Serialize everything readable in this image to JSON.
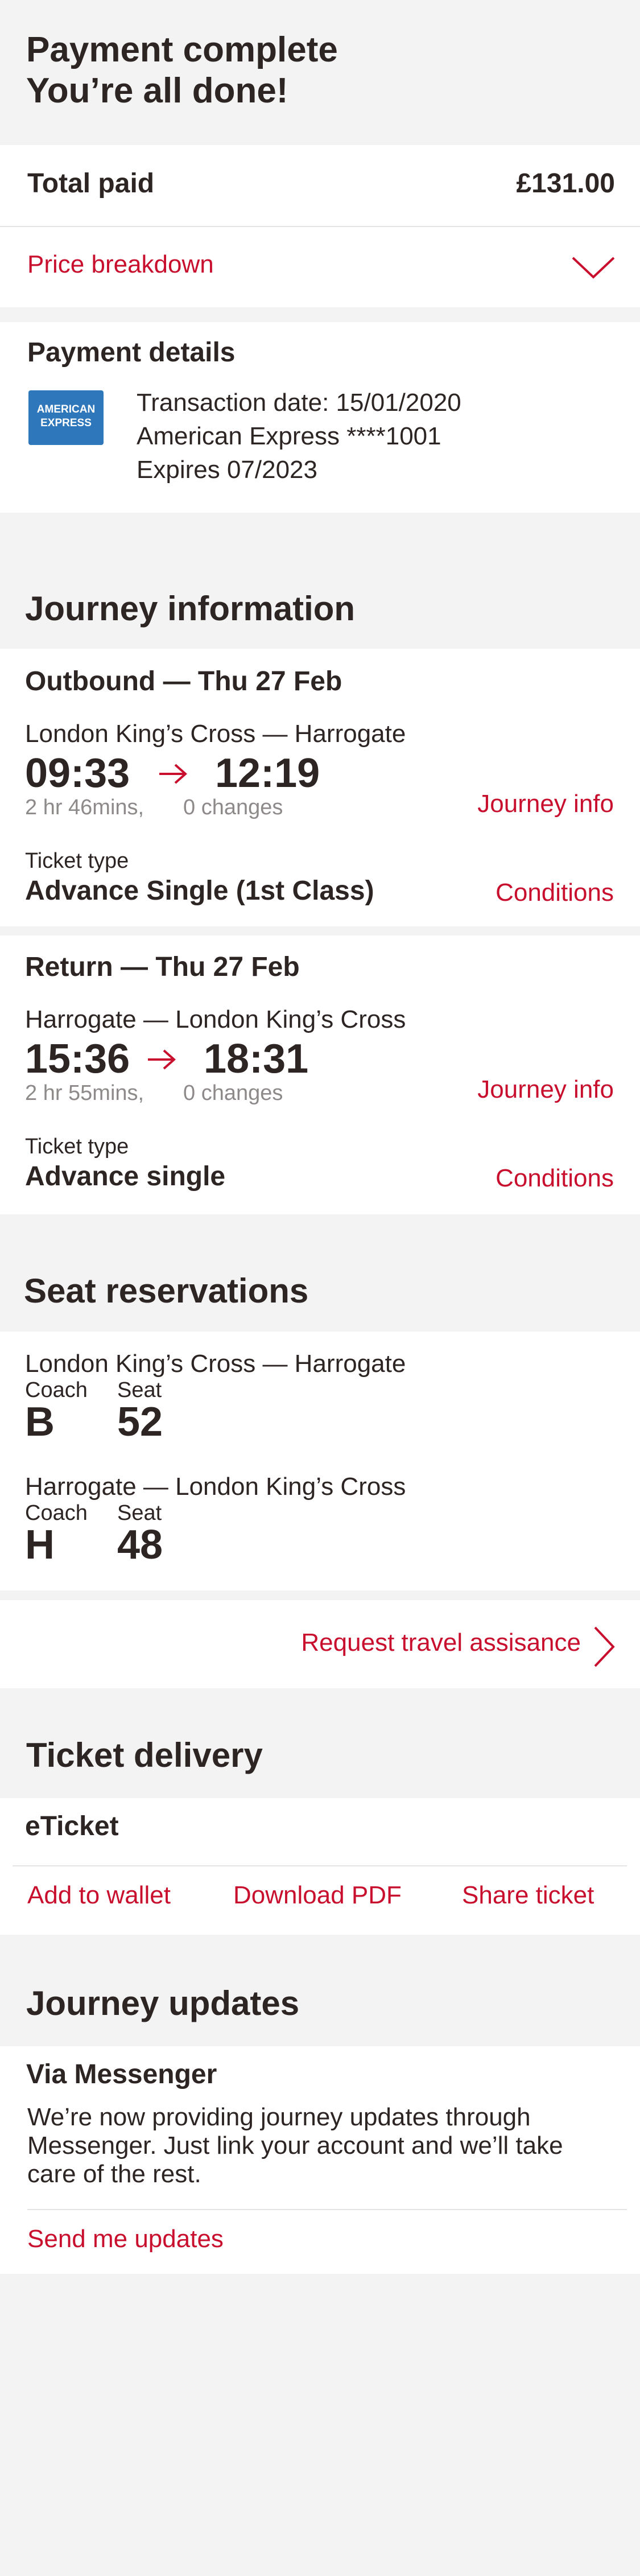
{
  "header": {
    "line1": "Payment complete",
    "line2": "You’re all done!"
  },
  "total": {
    "label": "Total paid",
    "amount": "£131.00"
  },
  "breakdown": {
    "label": "Price breakdown",
    "icon": "chevron-down-icon"
  },
  "payment": {
    "heading": "Payment details",
    "card_logo_line1": "AMERICAN",
    "card_logo_line2": "EXPRESS",
    "transaction": "Transaction date: 15/01/2020",
    "card": "American Express ****1001",
    "expires": "Expires 07/2023"
  },
  "journey": {
    "heading": "Journey information",
    "outbound": {
      "heading": "Outbound — Thu 27 Feb",
      "route": "London King’s Cross — Harrogate",
      "depart": "09:33",
      "arrive": "12:19",
      "duration": "2 hr  46mins,",
      "changes": "0  changes",
      "info_link": "Journey info",
      "ticket_type_label": "Ticket type",
      "ticket_type": "Advance Single (1st Class)",
      "conditions_link": "Conditions"
    },
    "return": {
      "heading": "Return — Thu 27 Feb",
      "route": "Harrogate — London King’s Cross",
      "depart": "15:36",
      "arrive": "18:31",
      "duration": "2 hr  55mins,",
      "changes": "0  changes",
      "info_link": "Journey info",
      "ticket_type_label": "Ticket type",
      "ticket_type": "Advance single",
      "conditions_link": "Conditions"
    }
  },
  "seats": {
    "heading": "Seat reservations",
    "items": [
      {
        "route": "London King’s Cross — Harrogate",
        "coach_label": "Coach",
        "coach": "B",
        "seat_label": "Seat",
        "seat": "52"
      },
      {
        "route": "Harrogate — London King’s Cross",
        "coach_label": "Coach",
        "coach": "H",
        "seat_label": "Seat",
        "seat": "48"
      }
    ],
    "assistance_link": "Request travel assisance"
  },
  "delivery": {
    "heading": "Ticket delivery",
    "type": "eTicket",
    "actions": [
      "Add to wallet",
      "Download PDF",
      "Share ticket"
    ]
  },
  "updates": {
    "heading": "Journey updates",
    "subheading": "Via Messenger",
    "body_line1": "We’re now providing journey updates through",
    "body_line2": "Messenger. Just link your account and we’ll take",
    "body_line3": "care of the rest.",
    "link": "Send me updates"
  },
  "colors": {
    "accent": "#c8102e",
    "text": "#2d2523",
    "background": "#f3f3f3",
    "amex": "#2e77bb"
  }
}
